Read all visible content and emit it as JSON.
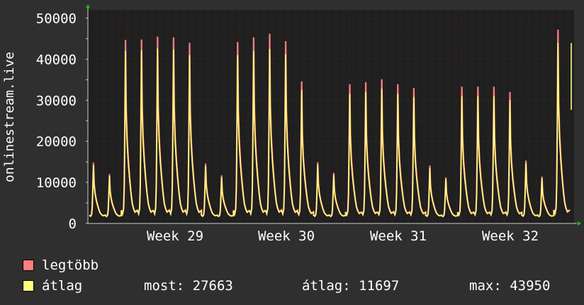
{
  "chart_data": {
    "type": "area",
    "ylabel": "onlinestream.live",
    "yticks": [
      "0",
      "10000",
      "20000",
      "30000",
      "40000",
      "50000"
    ],
    "ylim": [
      0,
      52000
    ],
    "xticks": [
      "Week 29",
      "Week 30",
      "Week 31",
      "Week 32"
    ],
    "grid": true,
    "series": [
      {
        "name": "legtöbb",
        "color": "#ff7f7f"
      },
      {
        "name": "átlag",
        "color": "#ffff80"
      }
    ],
    "daily_peak_max": [
      14800,
      12000,
      44700,
      44800,
      45500,
      45300,
      44000,
      14600,
      11700,
      44200,
      45300,
      46200,
      44400,
      34600,
      14900,
      12300,
      33900,
      34400,
      35100,
      33900,
      33000,
      14100,
      11200,
      33300,
      33300,
      33300,
      32000,
      15300,
      11400,
      47200
    ],
    "daily_peak_avg": [
      14200,
      11500,
      42000,
      42200,
      42600,
      42400,
      41000,
      14000,
      11200,
      41000,
      42000,
      42500,
      41200,
      32500,
      14300,
      11800,
      31600,
      32000,
      32800,
      31600,
      30800,
      13500,
      10800,
      31000,
      31000,
      31000,
      30000,
      14700,
      11000,
      43950
    ],
    "last": {
      "max": 47200,
      "avg": 27663
    },
    "colors": {
      "background": "#2f2f2f",
      "canvas": "#1f1f1f",
      "grid_major": "#5a2020",
      "grid_minor": "#3a2a2a",
      "axis": "#cccccc",
      "arrow": "#00cc00"
    }
  },
  "legend": {
    "items": [
      {
        "label": "legtöbb",
        "color": "#ff7f7f"
      },
      {
        "label": "átlag",
        "color": "#ffff80"
      }
    ],
    "stats": {
      "current": "most: 27663",
      "average": "átlag: 11697",
      "maximum": "max: 43950"
    }
  }
}
